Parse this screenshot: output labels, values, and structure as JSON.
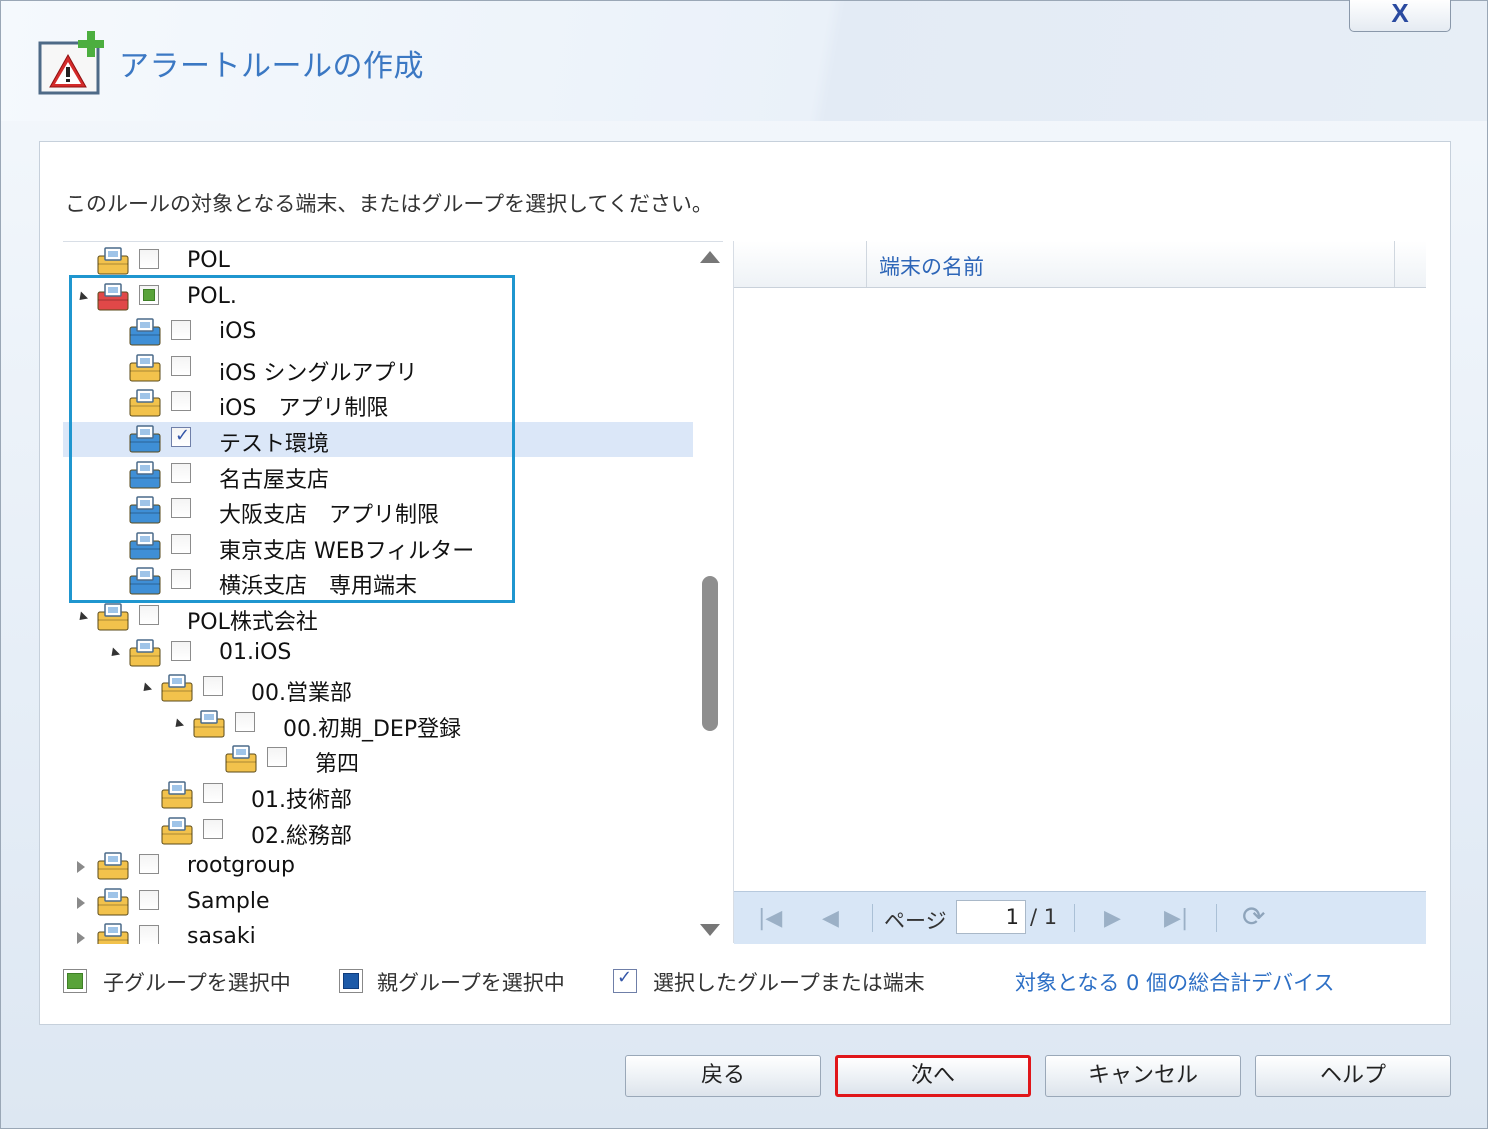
{
  "dialog": {
    "title": "アラートルールの作成",
    "close_label": "X",
    "instruction": "このルールの対象となる端末、またはグループを選択してください。"
  },
  "tree": {
    "rows": [
      {
        "label": "POL",
        "level": 0,
        "expander": "none",
        "icon": "folder-yellow",
        "check": "unchecked",
        "selected": false
      },
      {
        "label": "POL.",
        "level": 0,
        "expander": "open",
        "icon": "folder-red",
        "check": "partial",
        "selected": false
      },
      {
        "label": "iOS",
        "level": 1,
        "expander": "none",
        "icon": "folder-blue",
        "check": "unchecked",
        "selected": false
      },
      {
        "label": "iOS シングルアプリ",
        "level": 1,
        "expander": "none",
        "icon": "folder-yellow",
        "check": "unchecked",
        "selected": false
      },
      {
        "label": "iOS　アプリ制限",
        "level": 1,
        "expander": "none",
        "icon": "folder-yellow",
        "check": "unchecked",
        "selected": false
      },
      {
        "label": "テスト環境",
        "level": 1,
        "expander": "none",
        "icon": "folder-blue",
        "check": "checked",
        "selected": true
      },
      {
        "label": "名古屋支店",
        "level": 1,
        "expander": "none",
        "icon": "folder-blue",
        "check": "unchecked",
        "selected": false
      },
      {
        "label": "大阪支店　アプリ制限",
        "level": 1,
        "expander": "none",
        "icon": "folder-blue",
        "check": "unchecked",
        "selected": false
      },
      {
        "label": "東京支店 WEBフィルター",
        "level": 1,
        "expander": "none",
        "icon": "folder-blue",
        "check": "unchecked",
        "selected": false
      },
      {
        "label": "横浜支店　専用端末",
        "level": 1,
        "expander": "none",
        "icon": "folder-blue",
        "check": "unchecked",
        "selected": false
      },
      {
        "label": "POL株式会社",
        "level": 0,
        "expander": "open",
        "icon": "folder-yellow",
        "check": "unchecked",
        "selected": false
      },
      {
        "label": "01.iOS",
        "level": 1,
        "expander": "open",
        "icon": "folder-yellow",
        "check": "unchecked",
        "selected": false
      },
      {
        "label": "00.営業部",
        "level": 2,
        "expander": "open",
        "icon": "folder-yellow",
        "check": "unchecked",
        "selected": false
      },
      {
        "label": "00.初期_DEP登録",
        "level": 3,
        "expander": "open",
        "icon": "folder-yellow",
        "check": "unchecked",
        "selected": false
      },
      {
        "label": "第四",
        "level": 4,
        "expander": "none",
        "icon": "folder-yellow",
        "check": "unchecked",
        "selected": false
      },
      {
        "label": "01.技術部",
        "level": 2,
        "expander": "none",
        "icon": "folder-yellow",
        "check": "unchecked",
        "selected": false
      },
      {
        "label": "02.総務部",
        "level": 2,
        "expander": "none",
        "icon": "folder-yellow",
        "check": "unchecked",
        "selected": false
      },
      {
        "label": "rootgroup",
        "level": 0,
        "expander": "closed",
        "icon": "folder-yellow",
        "check": "unchecked",
        "selected": false
      },
      {
        "label": "Sample",
        "level": 0,
        "expander": "closed",
        "icon": "folder-yellow",
        "check": "unchecked",
        "selected": false
      },
      {
        "label": "sasaki",
        "level": 0,
        "expander": "closed",
        "icon": "folder-yellow",
        "check": "unchecked",
        "selected": false
      }
    ]
  },
  "grid": {
    "column_title": "端末の名前",
    "pager": {
      "page_label": "ページ",
      "current_page": "1",
      "total": "/ 1"
    }
  },
  "legend": {
    "child_selected": "子グループを選択中",
    "parent_selected": "親グループを選択中",
    "selected": "選択したグループまたは端末",
    "total_link": "対象となる 0 個の総合計デバイス"
  },
  "colors": {
    "child_selected": "#59a33a",
    "parent_selected": "#1d5aa8",
    "accent": "#3b78c3",
    "highlight_box": "#1f96cf",
    "primary_outline": "#e0161a"
  },
  "buttons": {
    "back": "戻る",
    "next": "次へ",
    "cancel": "キャンセル",
    "help": "ヘルプ"
  }
}
